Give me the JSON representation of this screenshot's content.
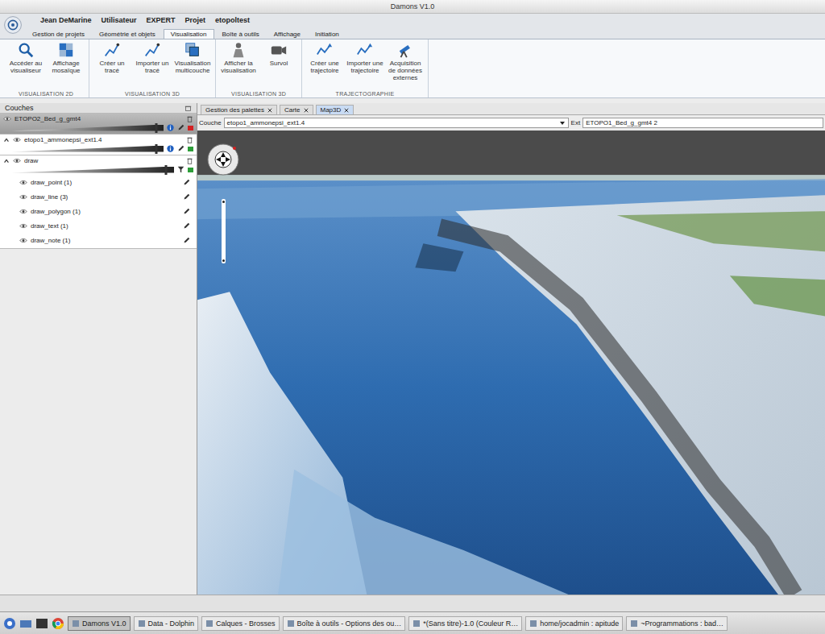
{
  "window": {
    "title": "Damons V1.0"
  },
  "user_bar": [
    "Jean DeMarine",
    "Utilisateur",
    "EXPERT",
    "Projet",
    "etopoltest"
  ],
  "ribbon_tabs": [
    {
      "label": "Gestion de projets",
      "selected": false
    },
    {
      "label": "Géométrie et objets",
      "selected": false
    },
    {
      "label": "Visualisation",
      "selected": true
    },
    {
      "label": "Boîte à outils",
      "selected": false
    },
    {
      "label": "Affichage",
      "selected": false
    },
    {
      "label": "Initiation",
      "selected": false
    }
  ],
  "ribbon_groups": [
    {
      "title": "VISUALISATION 2D",
      "buttons": [
        "Accéder au visualiseur",
        "Affichage mosaïque"
      ]
    },
    {
      "title": "VISUALISATION 3D",
      "buttons": [
        "Créer un tracé",
        "Importer un tracé",
        "Visualisation multicouche"
      ]
    },
    {
      "title": "VISUALISATION 3D",
      "buttons": [
        "Afficher la visualisation",
        "Survol"
      ]
    },
    {
      "title": "TRAJECTOGRAPHIE",
      "buttons": [
        "Créer une trajectoire",
        "Importer une trajectoire",
        "Acquisition de données externes"
      ]
    }
  ],
  "layers_panel": {
    "title": "Couches"
  },
  "layers": [
    {
      "name": "ETOPO2_Bed_g_gmt4",
      "selected": true,
      "expandable": false,
      "expanded": false,
      "level": 0.95,
      "color": "#d42020",
      "children": []
    },
    {
      "name": "etopo1_ammonepsi_ext1.4",
      "selected": false,
      "expandable": true,
      "expanded": true,
      "level": 0.95,
      "color": "#2e9e3a",
      "children": []
    },
    {
      "name": "draw",
      "selected": false,
      "expandable": true,
      "expanded": true,
      "level": 0.95,
      "color": "#2e9e3a",
      "children": [
        "draw_point (1)",
        "draw_line (3)",
        "draw_polygon (1)",
        "draw_text (1)",
        "draw_note (1)"
      ]
    }
  ],
  "doc_tabs": [
    {
      "label": "Gestion des palettes",
      "selected": false
    },
    {
      "label": "Carte",
      "selected": false
    },
    {
      "label": "Map3D",
      "selected": true
    }
  ],
  "map_toolbar": {
    "label": "Couche",
    "layer": "etopo1_ammonepsi_ext1.4",
    "ext_label": "Ext",
    "ext_layer": "ETOPO1_Bed_g_gmt4 2"
  },
  "taskbar": [
    {
      "label": "Damons V1.0",
      "selected": true
    },
    {
      "label": "Data - Dolphin",
      "selected": false
    },
    {
      "label": "Calques - Brosses",
      "selected": false
    },
    {
      "label": "Boîte à outils - Options des ou…",
      "selected": false
    },
    {
      "label": "*(Sans titre)-1.0 (Couleur R…",
      "selected": false
    },
    {
      "label": "home/jocadmin : apitude",
      "selected": false
    },
    {
      "label": "~Programmations : bad…",
      "selected": false
    }
  ]
}
